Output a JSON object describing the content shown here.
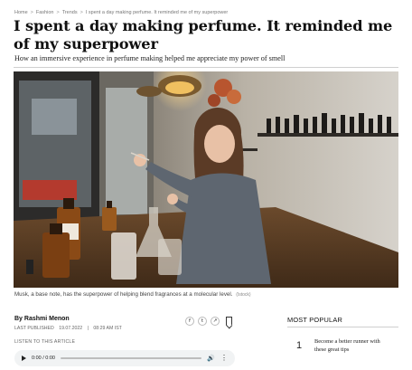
{
  "breadcrumb": {
    "items": [
      "Home",
      "Fashion",
      "Trends",
      "I spent a day making perfume. It reminded me of my superpower"
    ],
    "separator": ">"
  },
  "article": {
    "headline": "I spent a day making perfume. It reminded me of my superpower",
    "subheadline": "How an immersive experience in perfume making helped me appreciate my power of smell",
    "image_caption": "Musk, a base note, has the superpower of helping blend fragrances at a molecular level.",
    "image_credit": "(Istock)",
    "byline": "By Rashmi Menon",
    "published_label": "LAST PUBLISHED",
    "published_date": "19.07.2022",
    "published_time": "08:29 AM IST",
    "listen_label": "LISTEN TO THIS ARTICLE"
  },
  "player": {
    "time": "0:00 / 0:00",
    "play_icon": "play-icon",
    "volume_icon": "volume-icon",
    "more_icon": "more-options-icon"
  },
  "share": {
    "facebook_glyph": "f",
    "twitter_glyph": "t",
    "share_glyph": "↗"
  },
  "sidebar": {
    "popular_title": "MOST POPULAR",
    "items": [
      {
        "rank": "1",
        "title": "Become a better runner with these great tips"
      }
    ]
  }
}
